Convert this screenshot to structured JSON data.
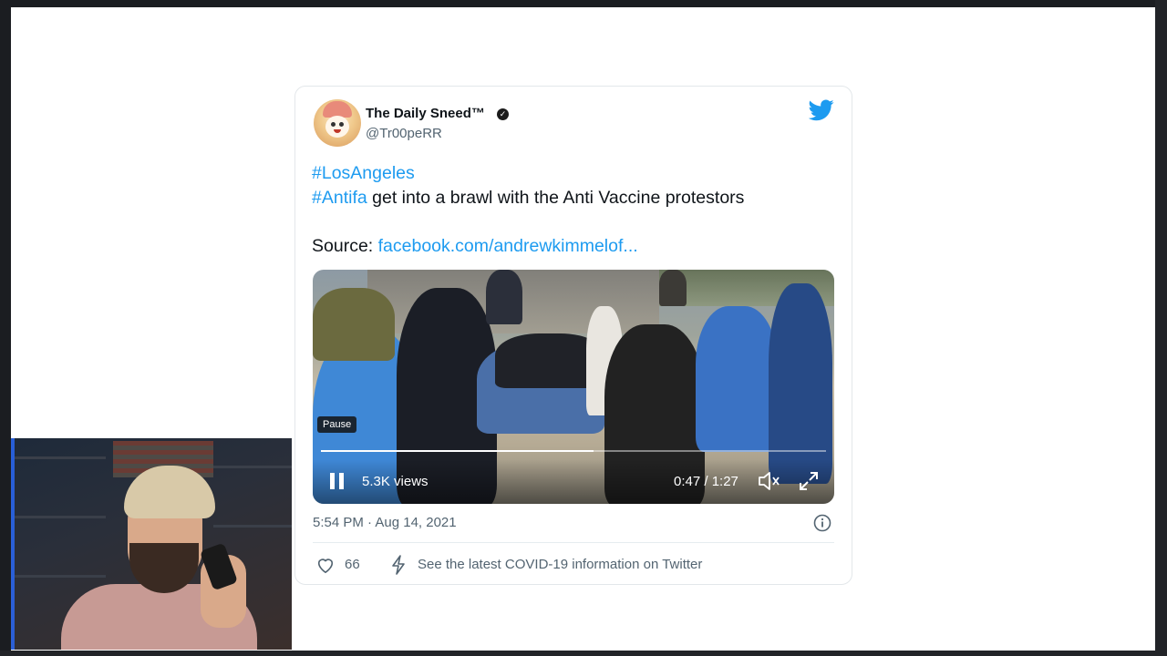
{
  "tweet": {
    "display_name": "The Daily Sneed™",
    "handle": "@Tr00peRR",
    "lines": {
      "hashtag1": "#LosAngeles",
      "hashtag2": "#Antifa",
      "line2_rest": " get into a brawl with the Anti Vaccine protestors",
      "source_label": "Source: ",
      "source_link": "facebook.com/andrewkimmelof..."
    },
    "video": {
      "pause_tooltip": "Pause",
      "views": "5.3K views",
      "time": "0:47 / 1:27",
      "progress": 0.54
    },
    "timestamp": "5:54 PM · Aug 14, 2021",
    "likes": "66",
    "covid_link": "See the latest COVID-19 information on Twitter"
  },
  "colors": {
    "link": "#1d9bf0",
    "secondary_text": "#536471"
  }
}
